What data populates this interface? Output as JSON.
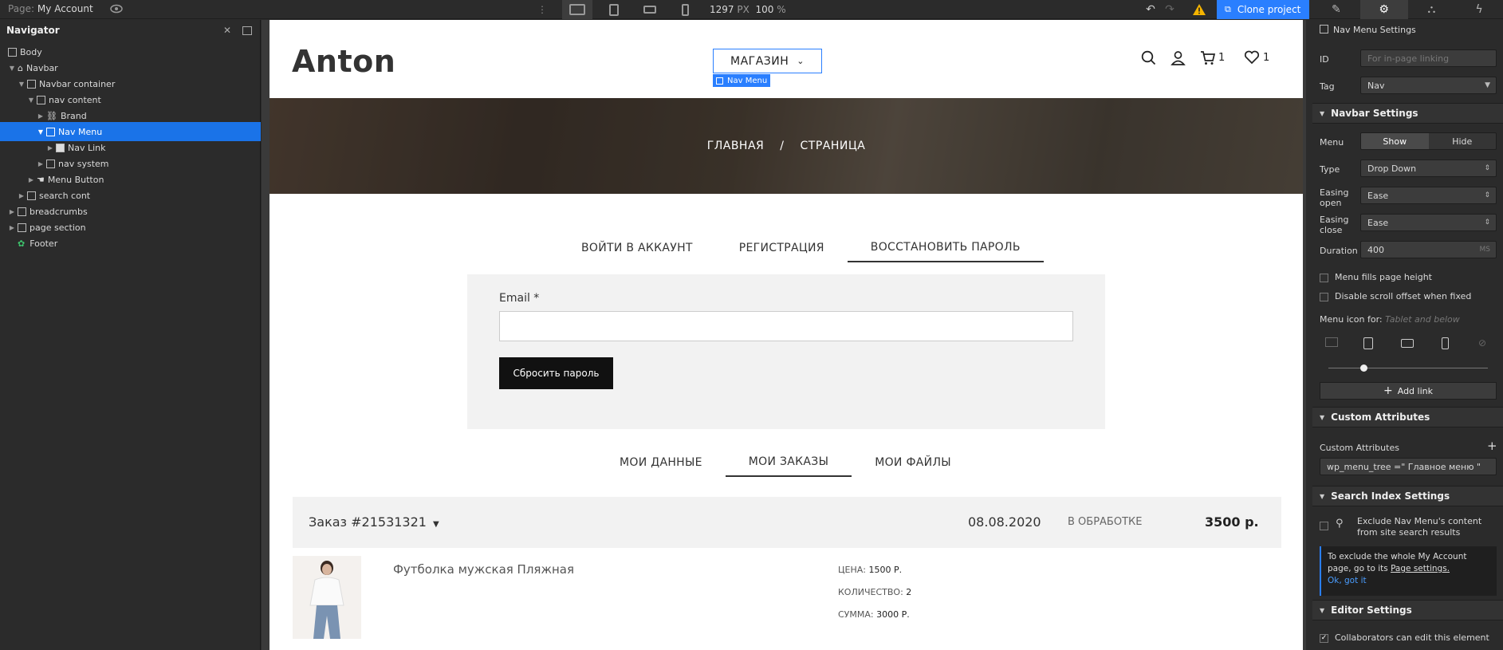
{
  "topbar": {
    "page_label": "Page:",
    "page_name": "My Account",
    "width_px": "1297",
    "px_unit": "PX",
    "zoom": "100",
    "zoom_unit": "%",
    "clone_label": "Clone project"
  },
  "navigator": {
    "title": "Navigator",
    "items": [
      {
        "label": "Body",
        "icon": "body-icon"
      },
      {
        "label": "Navbar",
        "icon": "home-icon"
      },
      {
        "label": "Navbar container",
        "icon": "container-icon"
      },
      {
        "label": "nav content",
        "icon": "div-block-icon"
      },
      {
        "label": "Brand",
        "icon": "link-icon"
      },
      {
        "label": "Nav Menu",
        "icon": "div-block-icon"
      },
      {
        "label": "Nav Link",
        "icon": "nav-link-icon"
      },
      {
        "label": "nav system",
        "icon": "div-block-icon"
      },
      {
        "label": "Menu Button",
        "icon": "hand-icon"
      },
      {
        "label": "search cont",
        "icon": "div-block-icon"
      },
      {
        "label": "breadcrumbs",
        "icon": "section-icon"
      },
      {
        "label": "page section",
        "icon": "section-icon"
      },
      {
        "label": "Footer",
        "icon": "symbol-icon"
      }
    ]
  },
  "site": {
    "logo": "Anton",
    "shop_menu": "МАГАЗИН",
    "nav_menu_tag": "Nav Menu",
    "cart_count": "1",
    "wish_count": "1",
    "crumb_home": "ГЛАВНАЯ",
    "crumb_sep": "/",
    "crumb_page": "СТРАНИЦА",
    "auth_tabs": [
      "ВОЙТИ В АККАУНТ",
      "РЕГИСТРАЦИЯ",
      "ВОССТАНОВИТЬ ПАРОЛЬ"
    ],
    "email_label": "Email *",
    "email_value": "",
    "reset_button": "Сбросить пароль",
    "account_tabs": [
      "МОИ ДАННЫЕ",
      "МОИ ЗАКАЗЫ",
      "МОИ ФАЙЛЫ"
    ],
    "order": {
      "number": "Заказ #21531321",
      "date": "08.08.2020",
      "status": "В ОБРАБОТКЕ",
      "sum": "3500 р."
    },
    "product": {
      "name": "Футболка мужская Пляжная",
      "price_label": "ЦЕНА:",
      "price": "1500 Р.",
      "qty_label": "КОЛИЧЕСТВО:",
      "qty": "2",
      "sum_label": "СУММА:",
      "sum": "3000 Р."
    }
  },
  "panel": {
    "header": "Nav Menu Settings",
    "id_label": "ID",
    "id_placeholder": "For in-page linking",
    "tag_label": "Tag",
    "tag_value": "Nav",
    "navbar_section": "Navbar Settings",
    "menu_label": "Menu",
    "menu_show": "Show",
    "menu_hide": "Hide",
    "type_label": "Type",
    "type_value": "Drop Down",
    "easing_open_label1": "Easing",
    "easing_open_label2": "open",
    "easing_open_value": "Ease",
    "easing_close_label1": "Easing",
    "easing_close_label2": "close",
    "easing_close_value": "Ease",
    "duration_label": "Duration",
    "duration_value": "400",
    "duration_unit": "MS",
    "fills_height": "Menu fills page height",
    "scroll_offset": "Disable scroll offset when fixed",
    "menu_icon_for": "Menu icon for:",
    "menu_icon_hint": "Tablet and below",
    "add_link": "Add link",
    "custom_attr_section": "Custom Attributes",
    "custom_attr_label": "Custom Attributes",
    "custom_attr_value": "wp_menu_tree =\" Главное меню \"",
    "search_section": "Search Index Settings",
    "exclude_text": "Exclude Nav Menu's content from site search results",
    "info_text": "To exclude the whole My Account page, go to its",
    "info_link": "Page settings.",
    "info_ok": "Ok, got it",
    "editor_section": "Editor Settings",
    "collab_text": "Collaborators can edit this element"
  }
}
